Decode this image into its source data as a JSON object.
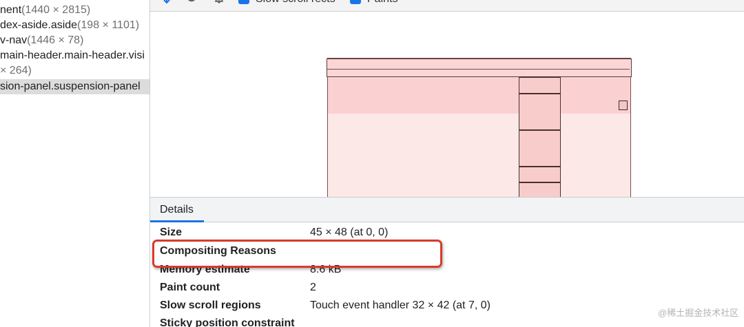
{
  "layer_tree": {
    "rows": [
      {
        "name": "nent",
        "dims": "(1440 × 2815)",
        "selected": false
      },
      {
        "name": "dex-aside.aside",
        "dims": "(198 × 1101)",
        "selected": false
      },
      {
        "name": "v-nav",
        "dims": "(1446 × 78)",
        "selected": false
      },
      {
        "name": "main-header.main-header.visi",
        "dims": "",
        "selected": false
      },
      {
        "name": "",
        "dims": "× 264)",
        "selected": false
      },
      {
        "name": "sion-panel.suspension-panel",
        "dims": "",
        "selected": true
      }
    ]
  },
  "toolbar": {
    "slow_scroll_label": "Slow scroll rects",
    "paints_label": "Paints",
    "checkbox_color": "#1a73e8"
  },
  "details": {
    "tab_label": "Details",
    "properties": [
      {
        "key": "Size",
        "value": "45 × 48 (at 0, 0)"
      },
      {
        "key": "Compositing Reasons",
        "value": ""
      },
      {
        "key": "Memory estimate",
        "value": "8.6 kB"
      },
      {
        "key": "Paint count",
        "value": "2"
      },
      {
        "key": "Slow scroll regions",
        "value": "Touch event handler 32 × 42 (at 7, 0)"
      },
      {
        "key": "Sticky position constraint",
        "value": ""
      }
    ]
  },
  "annotation": {
    "highlight_color": "#d93a2b"
  },
  "watermark": "@稀土掘金技术社区"
}
